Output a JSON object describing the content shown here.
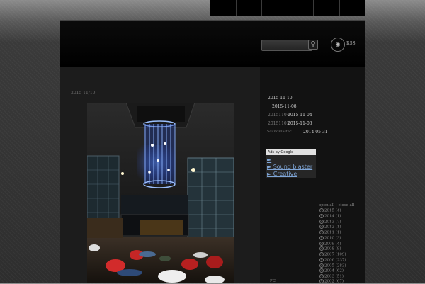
{
  "header": {
    "search": {
      "placeholder": ""
    },
    "search_button_icon": "magnifier-icon",
    "rss_icon": "rss-feed-icon",
    "rss_label": "RSS"
  },
  "post": {
    "date": "2015 11/10   ",
    "photo_icon": "photo-atrium-chandelier"
  },
  "sidebar": {
    "recent": [
      {
        "label": "2015-11-10",
        "dim": false
      },
      {
        "label": "2015-11-08",
        "dim": false
      },
      {
        "prefix": "20151104",
        "label": "2015-11-04"
      },
      {
        "prefix": "20151103",
        "label": "2015-11-03"
      },
      {
        "prefix": "SoundBlaster",
        "label": "2014-05-31"
      }
    ],
    "ads": {
      "header": "Ads by Google",
      "links": [
        "►",
        "► Sound blaster",
        "► Creative"
      ]
    },
    "archive": {
      "toggle": "open all | close all",
      "items": [
        "2015 (4)",
        "2014 (1)",
        "2013 (7)",
        "2012 (1)",
        "2011 (1)",
        "2010 (3)",
        "2009 (4)",
        "2008 (9)",
        "2007 (109)",
        "2006 (237)",
        "2005 (283)",
        "2004 (62)",
        "2003 (51)",
        "2002 (67)"
      ]
    },
    "bottom_label": "PC"
  }
}
